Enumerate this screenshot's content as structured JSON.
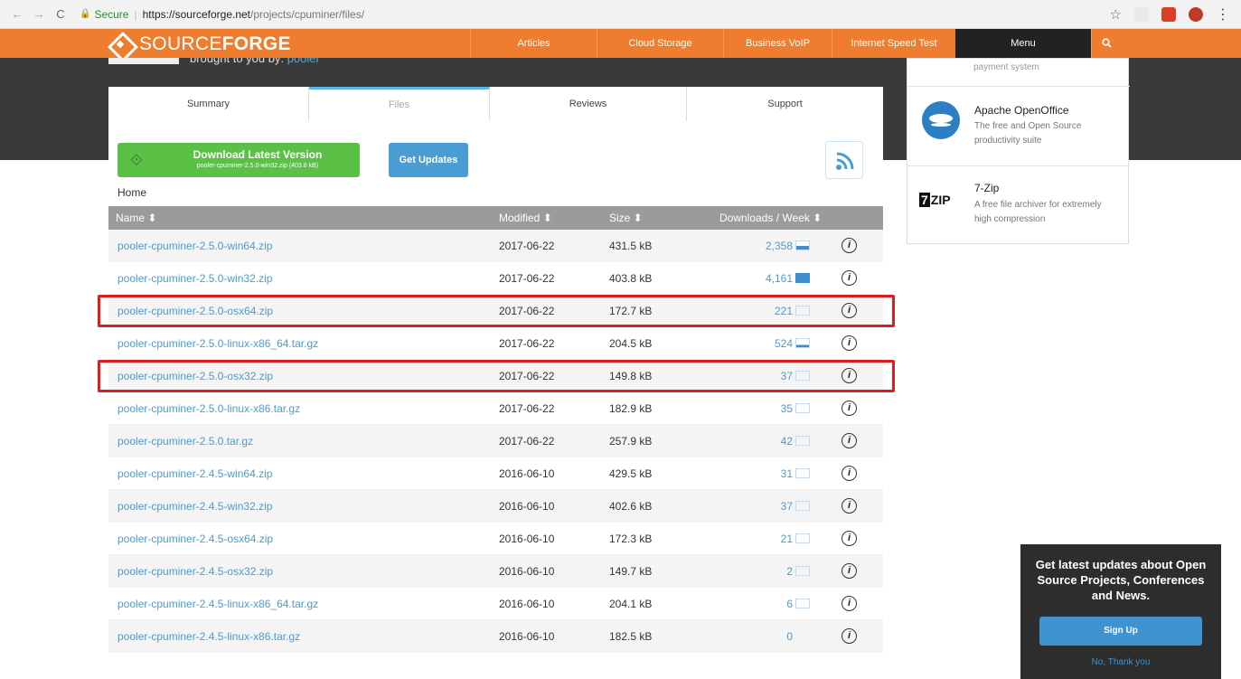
{
  "browser": {
    "secure_label": "Secure",
    "url_host": "https://sourceforge.net",
    "url_path": "/projects/cpuminer/files/"
  },
  "site": {
    "logo_text": "SOURCE",
    "logo_bold": "FORGE",
    "nav": [
      "Articles",
      "Cloud Storage",
      "Business VoIP",
      "Internet Speed Test"
    ],
    "menu_label": "Menu",
    "search_icon": "search-icon",
    "brought_by": "brought to you by:",
    "brought_by_user": "pooler"
  },
  "tabs": [
    "Summary",
    "Files",
    "Reviews",
    "Support"
  ],
  "download": {
    "title": "Download Latest Version",
    "file": "pooler-cpuminer-2.5.0-win32.zip (403.8 kB)",
    "updates_label": "Get Updates",
    "rss_icon": "rss-icon"
  },
  "breadcrumb": "Home",
  "table": {
    "headers": {
      "name": "Name ⬍",
      "modified": "Modified ⬍",
      "size": "Size ⬍",
      "downloads": "Downloads / Week ⬍"
    },
    "rows": [
      {
        "name": "pooler-cpuminer-2.5.0-win64.zip",
        "modified": "2017-06-22",
        "size": "431.5 kB",
        "downloads": "2,358",
        "weekly_level": 0.5
      },
      {
        "name": "pooler-cpuminer-2.5.0-win32.zip",
        "modified": "2017-06-22",
        "size": "403.8 kB",
        "downloads": "4,161",
        "weekly_level": 1.0
      },
      {
        "name": "pooler-cpuminer-2.5.0-osx64.zip",
        "modified": "2017-06-22",
        "size": "172.7 kB",
        "downloads": "221",
        "weekly_level": 0,
        "highlighted": true
      },
      {
        "name": "pooler-cpuminer-2.5.0-linux-x86_64.tar.gz",
        "modified": "2017-06-22",
        "size": "204.5 kB",
        "downloads": "524",
        "weekly_level": 0.25
      },
      {
        "name": "pooler-cpuminer-2.5.0-osx32.zip",
        "modified": "2017-06-22",
        "size": "149.8 kB",
        "downloads": "37",
        "weekly_level": 0,
        "highlighted": true
      },
      {
        "name": "pooler-cpuminer-2.5.0-linux-x86.tar.gz",
        "modified": "2017-06-22",
        "size": "182.9 kB",
        "downloads": "35",
        "weekly_level": 0
      },
      {
        "name": "pooler-cpuminer-2.5.0.tar.gz",
        "modified": "2017-06-22",
        "size": "257.9 kB",
        "downloads": "42",
        "weekly_level": 0
      },
      {
        "name": "pooler-cpuminer-2.4.5-win64.zip",
        "modified": "2016-06-10",
        "size": "429.5 kB",
        "downloads": "31",
        "weekly_level": 0
      },
      {
        "name": "pooler-cpuminer-2.4.5-win32.zip",
        "modified": "2016-06-10",
        "size": "402.6 kB",
        "downloads": "37",
        "weekly_level": 0
      },
      {
        "name": "pooler-cpuminer-2.4.5-osx64.zip",
        "modified": "2016-06-10",
        "size": "172.3 kB",
        "downloads": "21",
        "weekly_level": 0
      },
      {
        "name": "pooler-cpuminer-2.4.5-osx32.zip",
        "modified": "2016-06-10",
        "size": "149.7 kB",
        "downloads": "2",
        "weekly_level": 0
      },
      {
        "name": "pooler-cpuminer-2.4.5-linux-x86_64.tar.gz",
        "modified": "2016-06-10",
        "size": "204.1 kB",
        "downloads": "6",
        "weekly_level": 0
      },
      {
        "name": "pooler-cpuminer-2.4.5-linux-x86.tar.gz",
        "modified": "2016-06-10",
        "size": "182.5 kB",
        "downloads": "0",
        "weekly_level": null
      }
    ]
  },
  "popup": {
    "top_text": "payment system",
    "items": [
      {
        "title": "Apache OpenOffice",
        "desc": "The free and Open Source productivity suite",
        "icon": "openoffice-icon"
      },
      {
        "title": "7-Zip",
        "desc": "A free file archiver for extremely high compression",
        "icon": "7zip-icon",
        "icon_digit": "7",
        "icon_text": "ZIP"
      }
    ]
  },
  "newsletter": {
    "text": "Get latest updates about Open Source Projects, Conferences and News.",
    "signup": "Sign Up",
    "decline": "No, Thank you"
  },
  "colors": {
    "brand_orange": "#ef7d2f",
    "link_blue": "#4b9bd1",
    "download_green": "#5bc046",
    "highlight_red": "#d9201e"
  }
}
